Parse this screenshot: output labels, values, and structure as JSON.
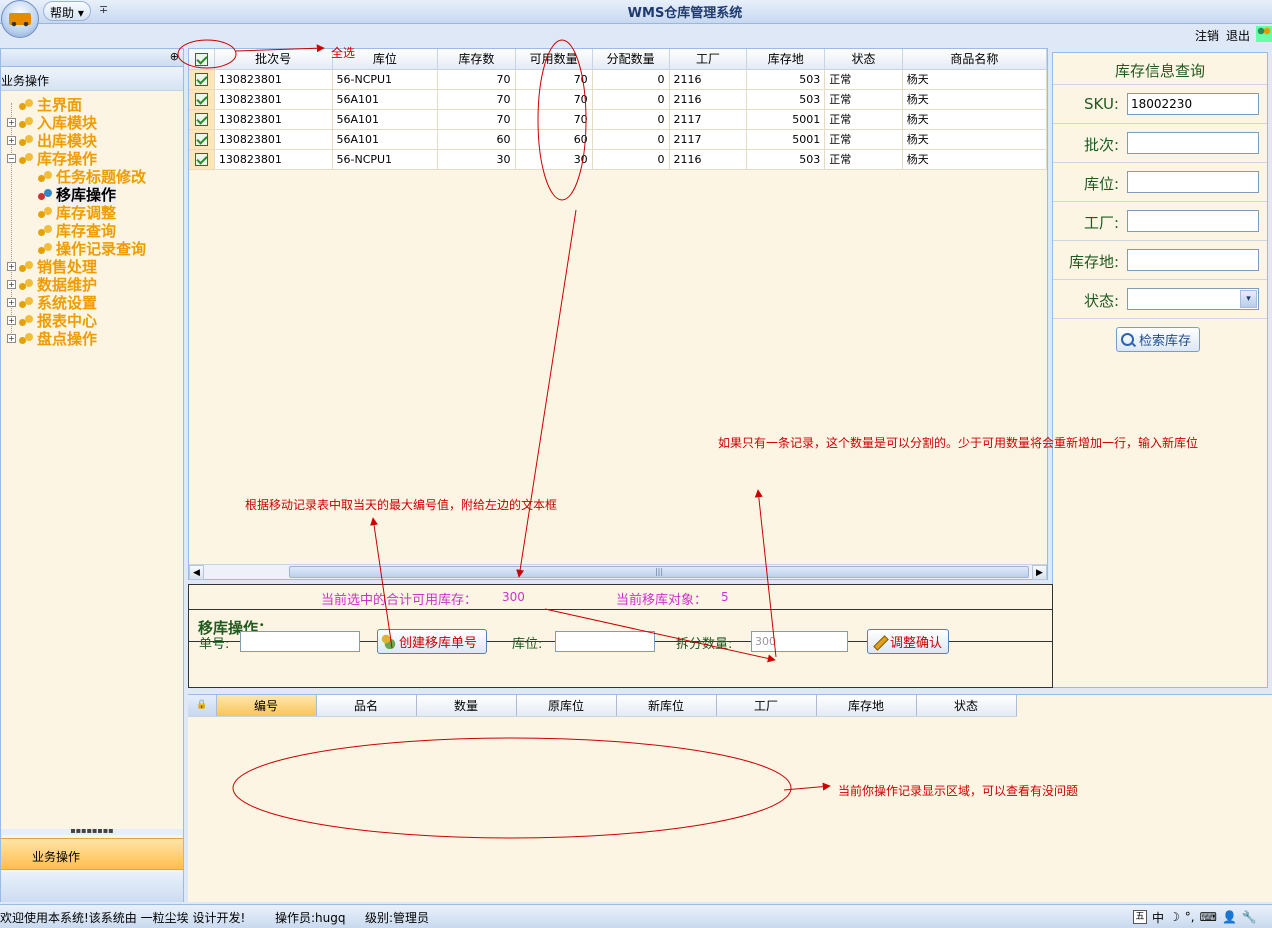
{
  "app": {
    "title": "WMS仓库管理系统",
    "help_menu": "帮助",
    "help_menu_arrow": "▾",
    "quick_access_arrow": "∓",
    "logout": "注销",
    "exit": "退出"
  },
  "left_panel": {
    "collapse_glyph": "⊕",
    "section_title": "业务操作",
    "tree": [
      {
        "label": "主界面",
        "expander": "",
        "level": 0
      },
      {
        "label": "入库模块",
        "expander": "+",
        "level": 0
      },
      {
        "label": "出库模块",
        "expander": "+",
        "level": 0
      },
      {
        "label": "库存操作",
        "expander": "−",
        "level": 0
      },
      {
        "label": "任务标题修改",
        "level": 1
      },
      {
        "label": "移库操作",
        "level": 1,
        "selected": true
      },
      {
        "label": "库存调整",
        "level": 1
      },
      {
        "label": "库存查询",
        "level": 1
      },
      {
        "label": "操作记录查询",
        "level": 1
      },
      {
        "label": "销售处理",
        "expander": "+",
        "level": 0
      },
      {
        "label": "数据维护",
        "expander": "+",
        "level": 0
      },
      {
        "label": "系统设置",
        "expander": "+",
        "level": 0
      },
      {
        "label": "报表中心",
        "expander": "+",
        "level": 0
      },
      {
        "label": "盘点操作",
        "expander": "+",
        "level": 0
      }
    ],
    "grip": "▪▪▪▪▪▪▪▪",
    "bottom_button": "业务操作"
  },
  "inventory_grid": {
    "columns": [
      "批次号",
      "库位",
      "库存数",
      "可用数量",
      "分配数量",
      "工厂",
      "库存地",
      "状态",
      "商品名称"
    ],
    "rows": [
      {
        "batch": "130823801",
        "location": "56-NCPU1",
        "stock": "70",
        "available": "70",
        "allocated": "0",
        "factory": "2116",
        "storage": "503",
        "status": "正常",
        "name": "杨天"
      },
      {
        "batch": "130823801",
        "location": "56A101",
        "stock": "70",
        "available": "70",
        "allocated": "0",
        "factory": "2116",
        "storage": "503",
        "status": "正常",
        "name": "杨天"
      },
      {
        "batch": "130823801",
        "location": "56A101",
        "stock": "70",
        "available": "70",
        "allocated": "0",
        "factory": "2117",
        "storage": "5001",
        "status": "正常",
        "name": "杨天"
      },
      {
        "batch": "130823801",
        "location": "56A101",
        "stock": "60",
        "available": "60",
        "allocated": "0",
        "factory": "2117",
        "storage": "5001",
        "status": "正常",
        "name": "杨天"
      },
      {
        "batch": "130823801",
        "location": "56-NCPU1",
        "stock": "30",
        "available": "30",
        "allocated": "0",
        "factory": "2116",
        "storage": "503",
        "status": "正常",
        "name": "杨天"
      }
    ],
    "scroll_left": "◀",
    "scroll_right": "▶",
    "scroll_grip": "|||"
  },
  "query_panel": {
    "title": "库存信息查询",
    "fields": [
      {
        "label": "SKU:",
        "value": "18002230"
      },
      {
        "label": "批次:",
        "value": ""
      },
      {
        "label": "库位:",
        "value": ""
      },
      {
        "label": "工厂:",
        "value": ""
      },
      {
        "label": "库存地:",
        "value": ""
      },
      {
        "label": "状态:",
        "value": "",
        "dropdown": "▾"
      }
    ],
    "search_button": "检索库存"
  },
  "move_panel": {
    "sum_label": "当前选中的合计可用库存：",
    "sum_value": "300",
    "target_label": "当前移库对象：",
    "target_value": "5",
    "title": "移库操作：",
    "order_label": "单号:",
    "order_value": "",
    "create_button": "创建移库单号",
    "location_label": "库位:",
    "location_value": "",
    "split_label": "拆分数量:",
    "split_value": "300",
    "confirm_button": "调整确认"
  },
  "log_grid": {
    "lock_glyph": "🔒",
    "columns": [
      "编号",
      "品名",
      "数量",
      "原库位",
      "新库位",
      "工厂",
      "库存地",
      "状态"
    ]
  },
  "statusbar": {
    "welcome": "欢迎使用本系统!该系统由 一粒尘埃 设计开发!",
    "operator": "操作员:hugq",
    "level": "级别:管理员",
    "ime": [
      "五",
      "中",
      "☽",
      "°,",
      "⌨",
      "👤",
      "🔧"
    ]
  },
  "annotations": {
    "select_all": "全选",
    "split_note": "如果只有一条记录，这个数量是可以分割的。少于可用数量将会重新增加一行，输入新库位",
    "order_note": "根据移动记录表中取当天的最大编号值，附给左边的文本框",
    "log_note": "当前你操作记录显示区域，可以查看有没问题"
  },
  "colors": {
    "annotation": "#cc0000",
    "tree_label": "#f09c00",
    "summary_text": "#cc33cc",
    "form_label": "#1f5a1f"
  }
}
